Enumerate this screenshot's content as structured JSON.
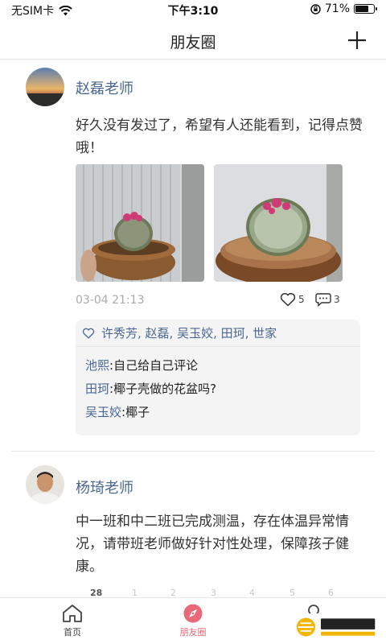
{
  "status_bar": {
    "carrier": "无SIM卡",
    "time": "下午3:10",
    "battery": "71%",
    "battery_level": 0.71
  },
  "nav": {
    "title": "朋友圈"
  },
  "posts": [
    {
      "author": "赵磊老师",
      "text": "好久没有发过了，希望有人还能看到，记得点赞哦！",
      "time": "03-04 21:13",
      "like_count": "5",
      "comment_count": "3",
      "likes": "许秀芳, 赵磊, 吴玉姣, 田珂, 世家",
      "comments": [
        {
          "name": "池熙",
          "text": "自己给自己评论"
        },
        {
          "name": "田珂",
          "text": "椰子壳做的花盆吗?"
        },
        {
          "name": "吴玉姣",
          "text": "椰子"
        }
      ]
    },
    {
      "author": "杨琦老师",
      "text": "中一班和中二班已完成测温，存在体温异常情况，请带班老师做好针对性处理，保障孩子健康。"
    }
  ],
  "calendar_strip": [
    "28",
    "1",
    "2",
    "3",
    "4",
    "5",
    "6"
  ],
  "tabs": [
    {
      "label": "首页",
      "active": false
    },
    {
      "label": "朋友圈",
      "active": true
    },
    {
      "label": "",
      "active": false
    }
  ],
  "colors": {
    "accent": "#e8697a",
    "name_blue": "#4a6791"
  }
}
